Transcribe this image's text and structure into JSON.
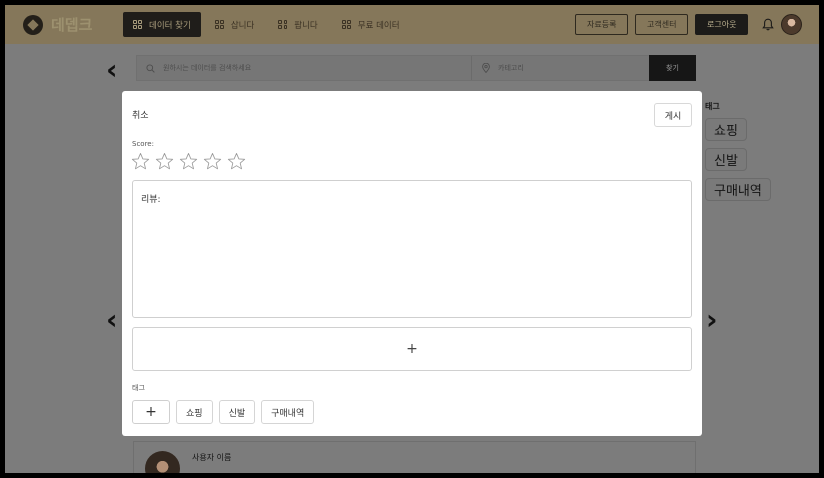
{
  "header": {
    "logo_text": "데뎁크",
    "nav": [
      {
        "label": "데이터 찾기",
        "active": true
      },
      {
        "label": "삽니다",
        "active": false
      },
      {
        "label": "팝니다",
        "active": false
      },
      {
        "label": "무료 데이터",
        "active": false
      }
    ],
    "register_label": "자료등록",
    "support_label": "고객센터",
    "logout_label": "로그아웃"
  },
  "search": {
    "placeholder": "원하시는 데이터를 검색하세요",
    "category_placeholder": "카테고리",
    "button_label": "찾기"
  },
  "sidebar_tags": {
    "title": "태그",
    "items": [
      "쇼핑",
      "신발",
      "구매내역"
    ]
  },
  "background_review": {
    "user_name": "사용자 이름"
  },
  "modal": {
    "cancel_label": "취소",
    "post_label": "게시",
    "score_label": "Score:",
    "star_count": 5,
    "rating": 0,
    "review_placeholder": "리뷰:",
    "add_image_symbol": "+",
    "tags_label": "태그",
    "tag_add_symbol": "+",
    "tags": [
      "쇼핑",
      "신발",
      "구매내역"
    ]
  },
  "colors": {
    "overlay": "#7c7c7c",
    "header_bg": "#85775a",
    "accent_dark": "#1c1b19",
    "modal_bg": "#ffffff"
  }
}
